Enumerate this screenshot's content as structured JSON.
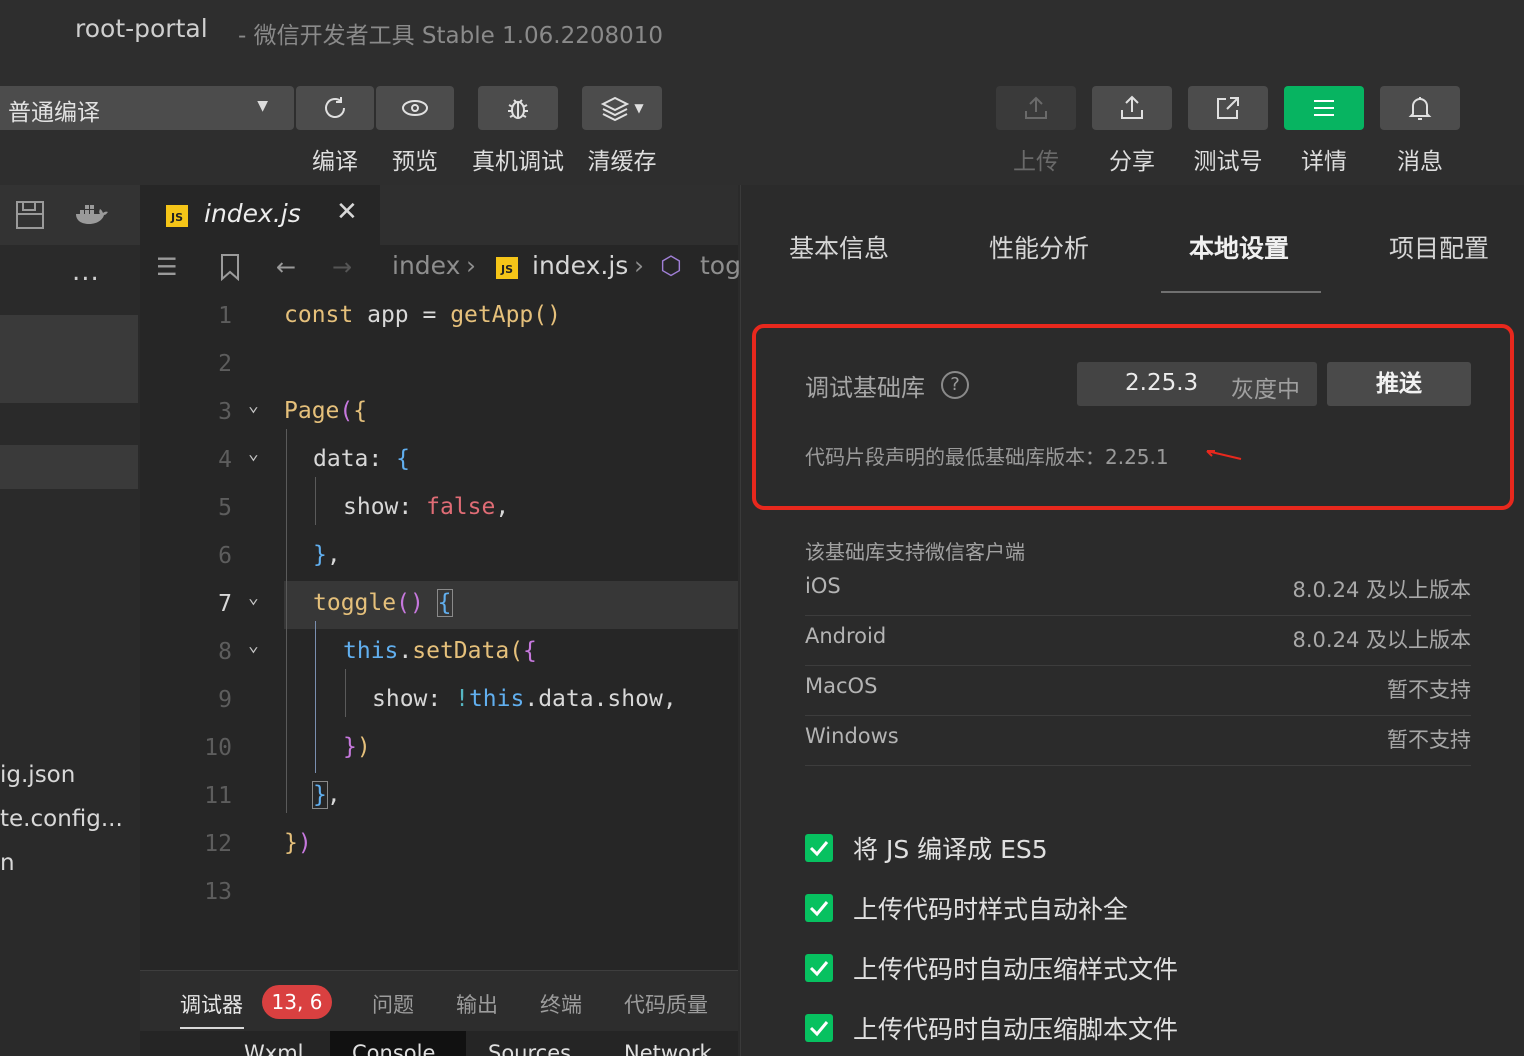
{
  "window": {
    "project": "root-portal",
    "subtitle": "-  微信开发者工具 Stable 1.06.2208010"
  },
  "toolbar": {
    "compile_mode": "普通编译",
    "buttons": [
      {
        "label": "编译",
        "icon": "refresh-icon"
      },
      {
        "label": "预览",
        "icon": "eye-icon"
      },
      {
        "label": "真机调试",
        "icon": "bug-icon"
      },
      {
        "label": "清缓存",
        "icon": "layers-icon"
      },
      {
        "label": "上传",
        "icon": "upload-icon",
        "disabled": true
      },
      {
        "label": "分享",
        "icon": "share-icon"
      },
      {
        "label": "测试号",
        "icon": "external-link-icon"
      },
      {
        "label": "详情",
        "icon": "menu-icon",
        "active": true
      },
      {
        "label": "消息",
        "icon": "bell-icon"
      }
    ]
  },
  "sidebar": {
    "more": "...",
    "files": [
      "ig.json",
      "te.config...",
      "n"
    ]
  },
  "editor": {
    "tab": {
      "name": "index.js",
      "badge": "JS"
    },
    "breadcrumb": [
      "index",
      "index.js",
      "tog"
    ],
    "line_numbers": [
      "1",
      "2",
      "3",
      "4",
      "5",
      "6",
      "7",
      "8",
      "9",
      "10",
      "11",
      "12",
      "13"
    ],
    "current_line": 7
  },
  "debugger": {
    "tabs": [
      "调试器",
      "问题",
      "输出",
      "终端",
      "代码质量"
    ],
    "count": "13, 6",
    "subtabs": [
      "Wxml",
      "Console",
      "Sources",
      "Network"
    ],
    "active_subtab": "Console"
  },
  "details": {
    "tabs": [
      "基本信息",
      "性能分析",
      "本地设置",
      "项目配置"
    ],
    "active_tab": "本地设置",
    "lib_label": "调试基础库",
    "lib_version": "2.25.3",
    "lib_status": "灰度中",
    "push_label": "推送",
    "min_version_note": "代码片段声明的最低基础库版本：2.25.1",
    "support_title": "该基础库支持微信客户端",
    "support": [
      {
        "os": "iOS",
        "value": "8.0.24 及以上版本"
      },
      {
        "os": "Android",
        "value": "8.0.24 及以上版本"
      },
      {
        "os": "MacOS",
        "value": "暂不支持"
      },
      {
        "os": "Windows",
        "value": "暂不支持"
      }
    ],
    "options": [
      {
        "label": "将 JS 编译成 ES5",
        "checked": true
      },
      {
        "label": "上传代码时样式自动补全",
        "checked": true
      },
      {
        "label": "上传代码时自动压缩样式文件",
        "checked": true
      },
      {
        "label": "上传代码时自动压缩脚本文件",
        "checked": true
      }
    ],
    "accent_red": "#e8281d",
    "accent_green": "#07c160"
  }
}
